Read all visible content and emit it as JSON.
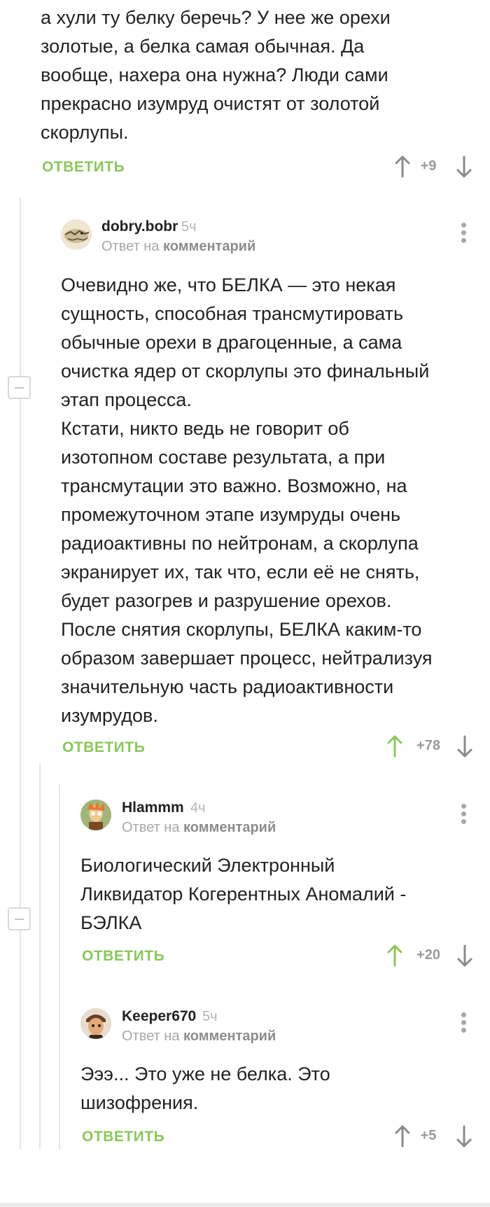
{
  "top_comment": {
    "text": "а хули ту белку беречь? У нее же орехи\nзолотые,  а белка самая обычная. Да\nвообще, нахера она нужна? Люди сами\nпрекрасно изумруд очистят от золотой\nскорлупы.",
    "reply_label": "ОТВЕТИТЬ",
    "score": "+9"
  },
  "comments": [
    {
      "username": "dobry.bobr",
      "time": "5ч",
      "reply_to_prefix": "Ответ на",
      "reply_to_link": "комментарий",
      "text": "Очевидно же, что БЕЛКА — это некая\nсущность, способная трансмутировать\nобычные орехи в драгоценные, а сама\nочистка ядер от скорлупы это финальный\nэтап процесса.\nКстати, никто ведь не говорит об\nизотопном составе результата, а при\nтрансмутации это важно. Возможно, на\nпромежуточном этапе изумруды очень\nрадиоактивны по нейтронам, а скорлупа\nэкранирует их, так что, если её не снять,\nбудет разогрев и разрушение орехов.\nПосле снятия скорлупы, БЕЛКА каким-то\nобразом завершает процесс, нейтрализуя\nзначительную часть радиоактивности\nизумрудов.",
      "reply_label": "ОТВЕТИТЬ",
      "score": "+78",
      "upvoted": true
    },
    {
      "username": "Hlammm",
      "time": "4ч",
      "reply_to_prefix": "Ответ на",
      "reply_to_link": "комментарий",
      "text": "Биологический Электронный\nЛиквидатор Когерентных Аномалий -\nБЭЛКА",
      "reply_label": "ОТВЕТИТЬ",
      "score": "+20",
      "upvoted": true
    },
    {
      "username": "Keeper670",
      "time": "5ч",
      "reply_to_prefix": "Ответ на",
      "reply_to_link": "комментарий",
      "text": "Эээ... Это уже не белка. Это\nшизофрения.",
      "reply_label": "ОТВЕТИТЬ",
      "score": "+5",
      "upvoted": false
    }
  ],
  "colors": {
    "accent_green": "#8ac858",
    "arrow_gray": "#8a8a8a",
    "score_gray": "#9a9a9a"
  }
}
